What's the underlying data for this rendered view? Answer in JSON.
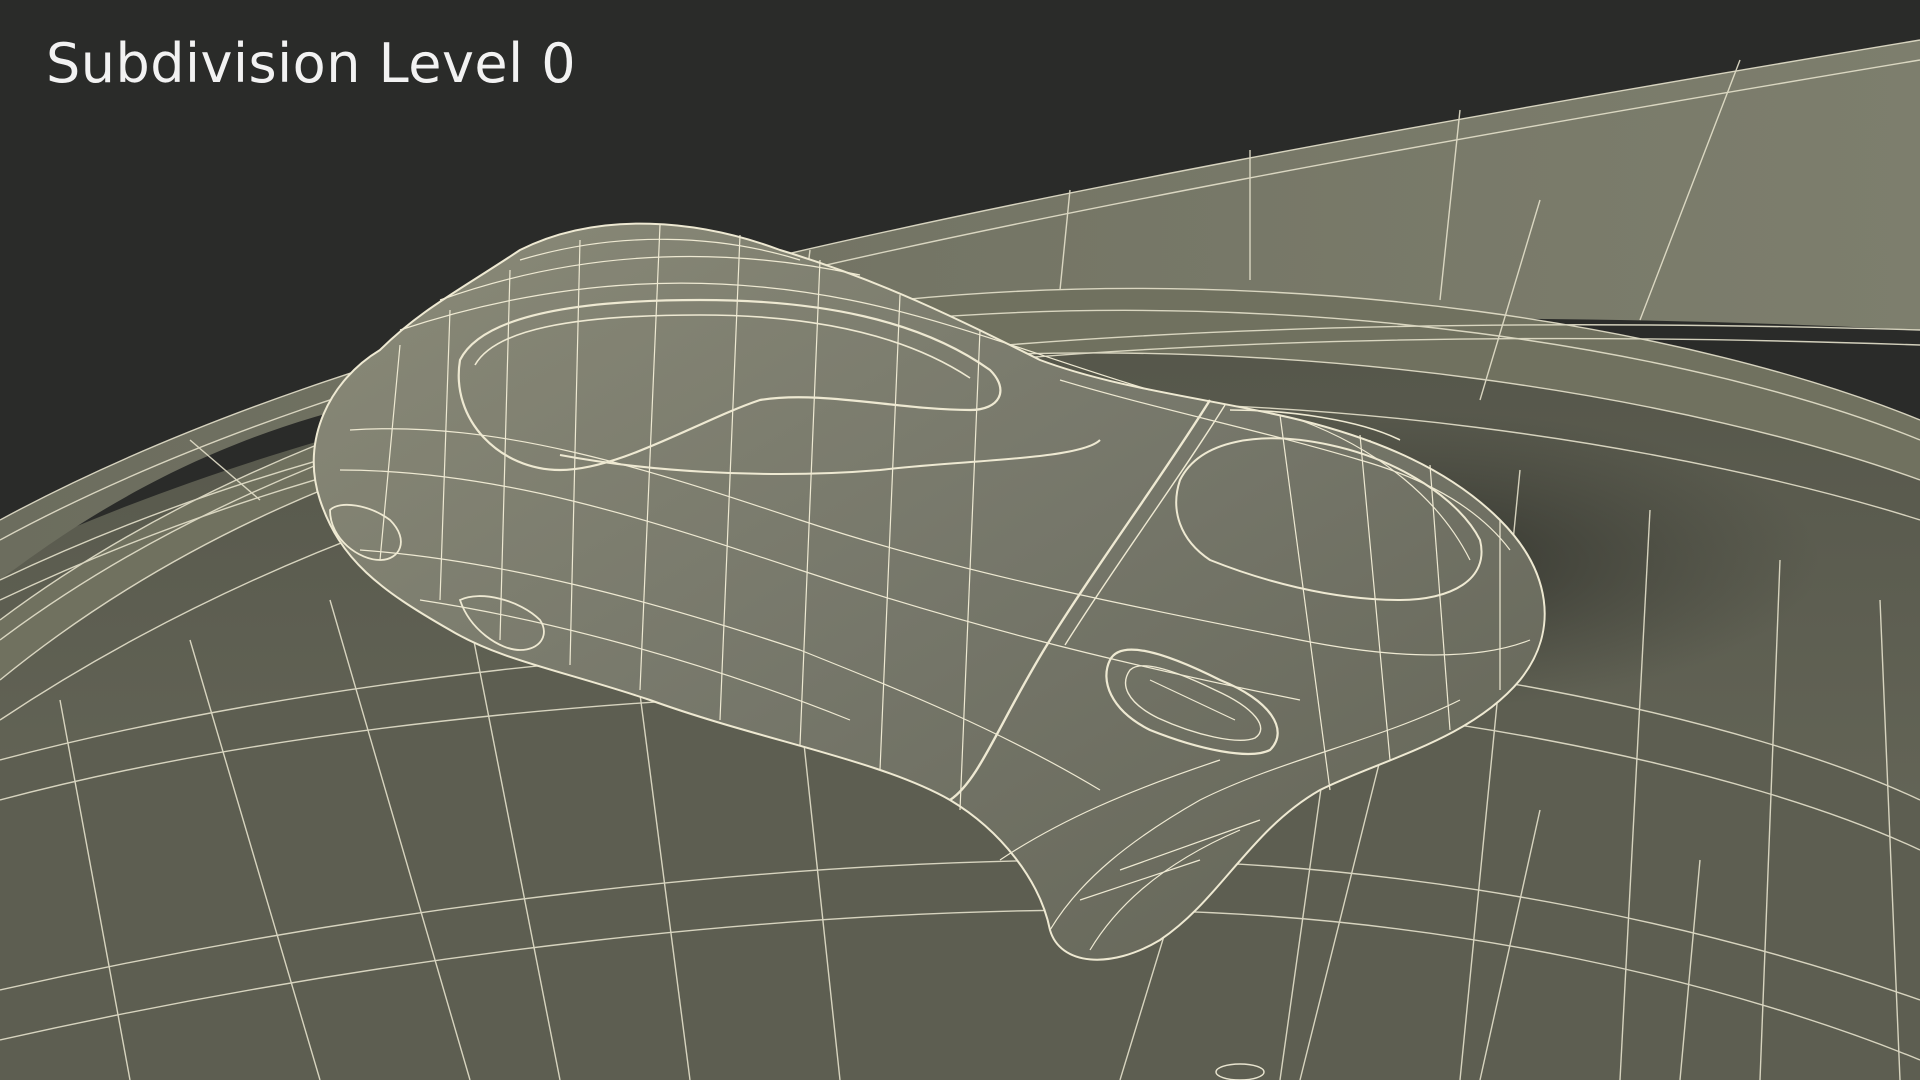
{
  "viewport": {
    "label": "Subdivision Level 0",
    "colors": {
      "background": "#2a2b29",
      "surface_light": "#7a7a6a",
      "surface_mid": "#6a6b5c",
      "surface_dark": "#4a4b40",
      "wire": "#e8e4cf"
    }
  }
}
